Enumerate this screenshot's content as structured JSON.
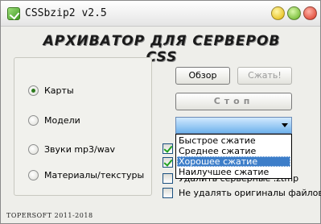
{
  "window": {
    "title": "CSSbzip2 v2.5",
    "banner": "АРХИВАТОР ДЛЯ СЕРВЕРОВ CSS"
  },
  "radios": {
    "items": [
      {
        "label": "Карты",
        "checked": true
      },
      {
        "label": "Модели",
        "checked": false
      },
      {
        "label": "Звуки mp3/wav",
        "checked": false
      },
      {
        "label": "Материалы/текстуры",
        "checked": false
      }
    ]
  },
  "buttons": {
    "browse": "Обзор",
    "compress": "Сжать!",
    "stop": "Стоп"
  },
  "compression": {
    "selected": "",
    "options": [
      "Быстрое сжатие",
      "Среднее сжатие",
      "Хорошее сжатие",
      "Наилучшее сжатие"
    ],
    "highlighted_index": 2
  },
  "checkboxes": [
    {
      "label": "",
      "checked": true
    },
    {
      "label": "",
      "checked": true
    },
    {
      "label": "Удалить серверные .ztmp",
      "checked": false
    },
    {
      "label": "Не удалять оригиналы файлов",
      "checked": false
    }
  ],
  "footer": {
    "text": "TOPERSOFT 2011-2018"
  }
}
